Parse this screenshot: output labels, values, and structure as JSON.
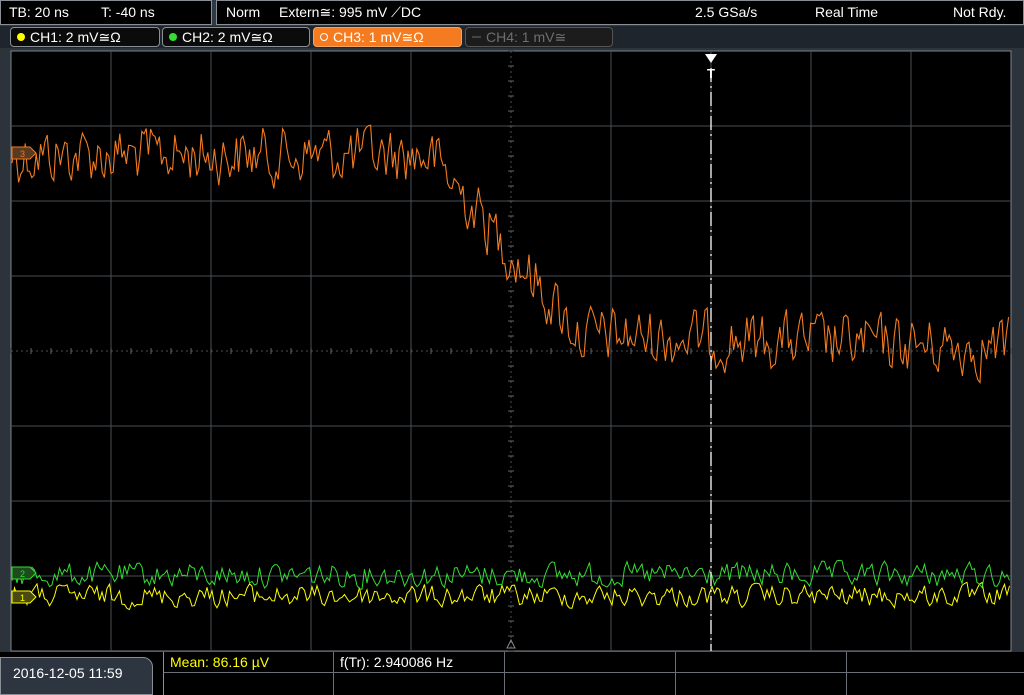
{
  "status_bar": {
    "timebase": "TB: 20 ns",
    "trigger_time": "T: -40 ns",
    "mode": "Norm",
    "trigger_source": "Extern≅: 995 mV ⟋DC",
    "sample_rate": "2.5 GSa/s",
    "acquisition": "Real Time",
    "state": "Not Rdy."
  },
  "channels": [
    {
      "label": "CH1: 2 mV≅Ω",
      "color": "#ffff00",
      "state": "on"
    },
    {
      "label": "CH2: 2 mV≅Ω",
      "color": "#33dd33",
      "state": "on"
    },
    {
      "label": "CH3: 1 mV≅Ω",
      "color": "#f47b20",
      "state": "active"
    },
    {
      "label": "CH4: 1 mV≅",
      "color": "#555555",
      "state": "off"
    }
  ],
  "markers": {
    "trigger": "T",
    "ch3_level": "3",
    "ch2_level": "2",
    "ch1_level": "1"
  },
  "footer": {
    "datetime": "2016-12-05 11:59",
    "mean": "Mean: 86.16 µV",
    "frequency": "f(Tr): 2.940086 Hz"
  },
  "colors": {
    "grid": "#555555",
    "ch1": "#ffff00",
    "ch2": "#33dd33",
    "ch3": "#f47b20"
  }
}
